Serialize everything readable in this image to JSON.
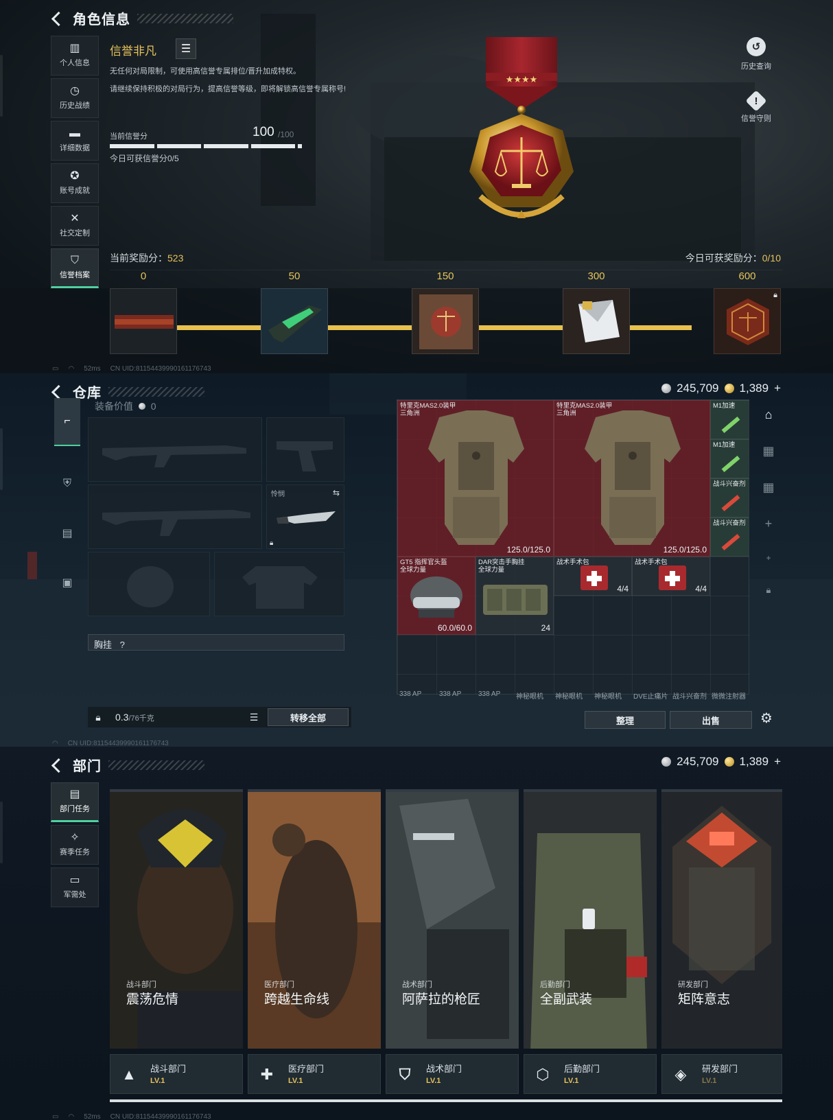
{
  "profile": {
    "title": "角色信息",
    "nav": [
      {
        "label": "个人信息",
        "icon": "bar-chart-icon"
      },
      {
        "label": "历史战绩",
        "icon": "clock-icon"
      },
      {
        "label": "详细数据",
        "icon": "folder-icon"
      },
      {
        "label": "账号成就",
        "icon": "achievement-icon"
      },
      {
        "label": "社交定制",
        "icon": "tools-icon"
      },
      {
        "label": "信誉档案",
        "icon": "shield-icon",
        "active": true
      }
    ],
    "honor_name": "信誉非凡",
    "desc1": "无任何对局限制，可使用高信誉专属排位/晋升加成特权。",
    "desc2": "请继续保持积极的对局行为，提高信誉等级，即将解锁高信誉专属称号!",
    "score_label": "当前信誉分",
    "score_value": "100",
    "score_max": "/100",
    "today_score": "今日可获信誉分0/5",
    "history_label": "历史查询",
    "rules_label": "信誉守则",
    "reward_current_label": "当前奖励分：",
    "reward_current_value": "523",
    "reward_today_label": "今日可获奖励分：",
    "reward_today_value": "0/10",
    "milestones": [
      "0",
      "50",
      "150",
      "300",
      "600"
    ],
    "footer_ping": "52ms",
    "footer_uid": "CN UID:8115443999016117674​3"
  },
  "warehouse": {
    "title": "仓库",
    "silver": "245,709",
    "gold": "1,389",
    "gold_plus": "+",
    "equip_value_label": "装备价值",
    "equip_value": "0",
    "melee_label": "怜悯",
    "chest_label": "胸挂",
    "chest_q": "?",
    "weight": "0.3",
    "weight_unit": "/76千克",
    "transfer_all": "转移全部",
    "sort": "整理",
    "sell": "出售",
    "items": [
      {
        "name": "特里克MAS2.0装甲\n三角洲",
        "qty": "125.0/125.0"
      },
      {
        "name": "特里克MAS2.0装甲\n三角洲",
        "qty": "125.0/125.0"
      },
      {
        "name": "M1加速",
        "qty": ""
      },
      {
        "name": "M1加速",
        "qty": ""
      },
      {
        "name": "战斗兴奋剂",
        "qty": ""
      },
      {
        "name": "战斗兴奋剂",
        "qty": ""
      },
      {
        "name": "GT5 指挥官头盔\n全球力量",
        "qty": "60.0/60.0"
      },
      {
        "name": "DAR突击手胸挂\n全球力量",
        "qty": "24"
      },
      {
        "name": "战术手术包",
        "qty": "4/4"
      },
      {
        "name": "战术手术包",
        "qty": "4/4"
      }
    ],
    "ammo": [
      "338 AP",
      "338 AP",
      "338 AP",
      "神秘眼机",
      "神秘眼机",
      "神秘眼机",
      "DVE止痛片",
      "战斗兴奋剂",
      "微微注射器"
    ],
    "footer_uid": "CN UID:8115443999016117674​3"
  },
  "department": {
    "title": "部门",
    "silver": "245,709",
    "gold": "1,389",
    "gold_plus": "+",
    "nav": [
      {
        "label": "部门任务",
        "icon": "task-icon",
        "active": true
      },
      {
        "label": "赛季任务",
        "icon": "season-icon"
      },
      {
        "label": "军需处",
        "icon": "supply-icon"
      }
    ],
    "cards": [
      {
        "sub": "战斗部门",
        "big": "震荡危情",
        "foot": "战斗部门",
        "lv": "LV.1",
        "icon": "combat-icon"
      },
      {
        "sub": "医疗部门",
        "big": "跨越生命线",
        "foot": "医疗部门",
        "lv": "LV.1",
        "icon": "medical-icon"
      },
      {
        "sub": "战术部门",
        "big": "阿萨拉的枪匠",
        "foot": "战术部门",
        "lv": "LV.1",
        "icon": "tactical-icon"
      },
      {
        "sub": "后勤部门",
        "big": "全副武装",
        "foot": "后勤部门",
        "lv": "LV.1",
        "icon": "logistics-icon"
      },
      {
        "sub": "研发部门",
        "big": "矩阵意志",
        "foot": "研发部门",
        "lv": "LV.1",
        "icon": "research-icon"
      }
    ],
    "footer_ping": "52ms",
    "footer_uid": "CN UID:8115443999016117674​3"
  },
  "colors": {
    "gold": "#e8c25b",
    "accent": "#4fd1a0",
    "track": "#e8c14f",
    "red_item": "#78202a"
  }
}
